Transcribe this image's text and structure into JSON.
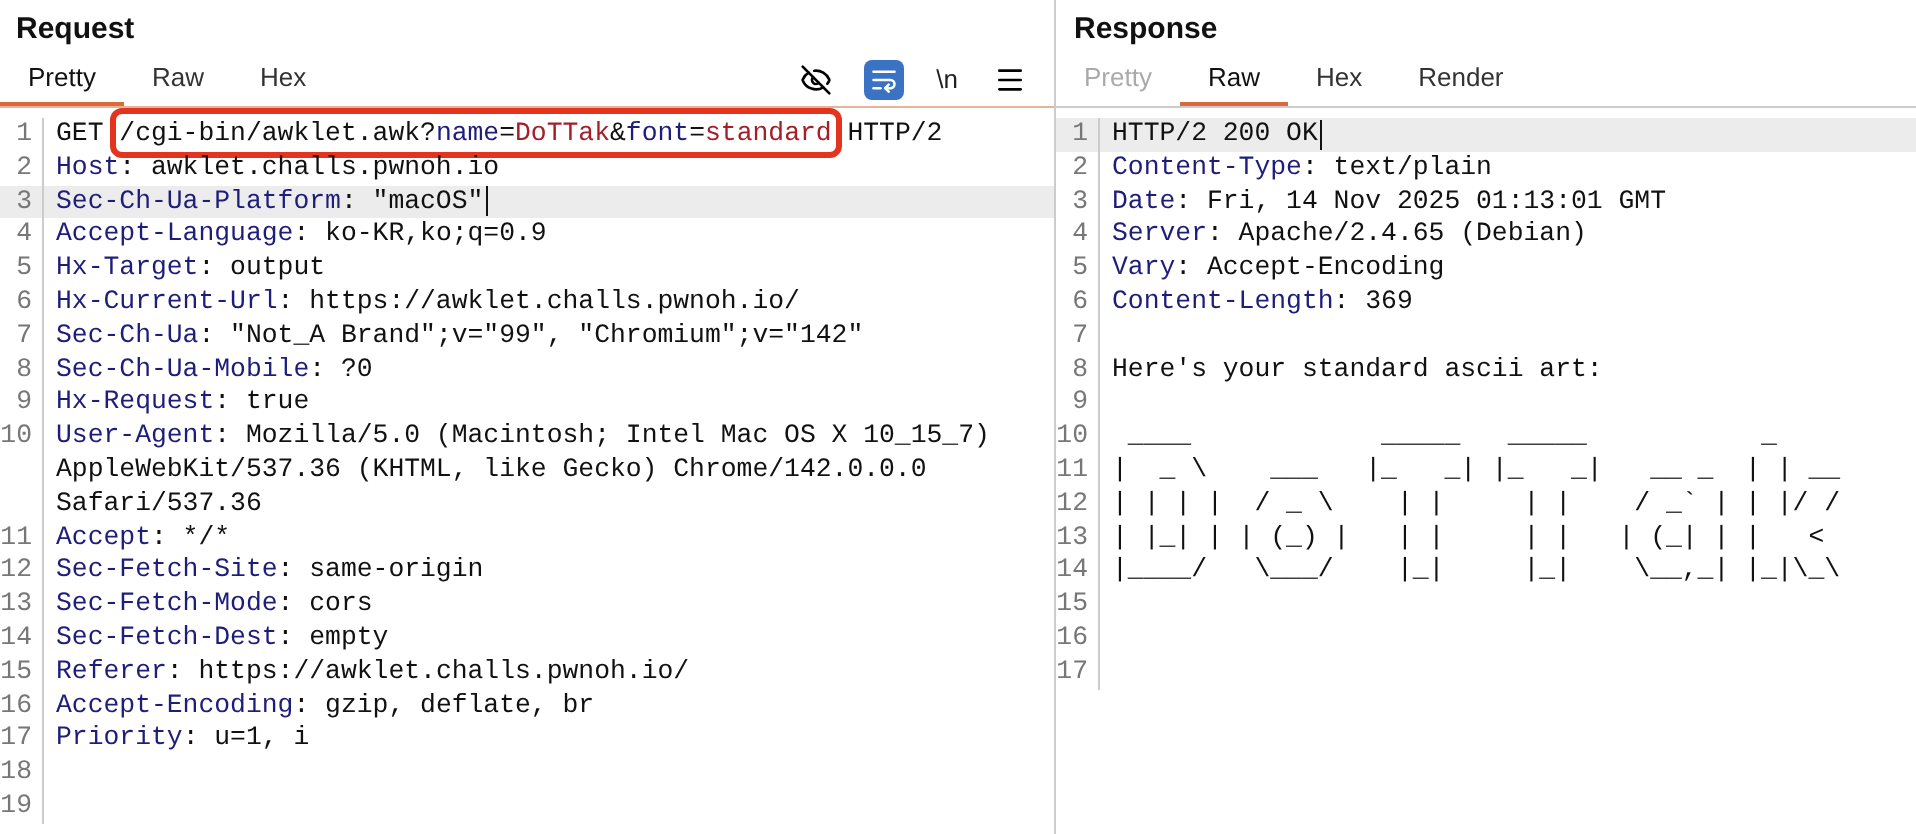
{
  "request": {
    "title": "Request",
    "tabs": [
      {
        "label": "Pretty",
        "selected": true,
        "disabled": false
      },
      {
        "label": "Raw",
        "selected": false,
        "disabled": false
      },
      {
        "label": "Hex",
        "selected": false,
        "disabled": false
      }
    ],
    "toolbar": [
      {
        "kind": "hide"
      },
      {
        "kind": "wrap",
        "on": true
      },
      {
        "kind": "text",
        "label": "\\n"
      },
      {
        "kind": "menu"
      }
    ],
    "lines": [
      {
        "number": "1",
        "current": false,
        "segments": [
          {
            "kind": "plain",
            "text": "GET "
          },
          {
            "kind": "box",
            "segments": [
              {
                "kind": "plain",
                "text": "/cgi-bin/awklet.awk?"
              },
              {
                "kind": "key",
                "text": "name"
              },
              {
                "kind": "plain",
                "text": "="
              },
              {
                "kind": "param",
                "text": "DoTTak"
              },
              {
                "kind": "plain",
                "text": "&"
              },
              {
                "kind": "key",
                "text": "font"
              },
              {
                "kind": "plain",
                "text": "="
              },
              {
                "kind": "param",
                "text": "standard"
              }
            ]
          },
          {
            "kind": "plain",
            "text": " HTTP/2"
          }
        ]
      },
      {
        "number": "2",
        "current": false,
        "segments": [
          {
            "kind": "key",
            "text": "Host"
          },
          {
            "kind": "plain",
            "text": ": awklet.challs.pwnoh.io"
          }
        ]
      },
      {
        "number": "3",
        "current": true,
        "segments": [
          {
            "kind": "key",
            "text": "Sec-Ch-Ua-Platform"
          },
          {
            "kind": "plain",
            "text": ": \"macOS\""
          }
        ]
      },
      {
        "number": "4",
        "current": false,
        "segments": [
          {
            "kind": "key",
            "text": "Accept-Language"
          },
          {
            "kind": "plain",
            "text": ": ko-KR,ko;q=0.9"
          }
        ]
      },
      {
        "number": "5",
        "current": false,
        "segments": [
          {
            "kind": "key",
            "text": "Hx-Target"
          },
          {
            "kind": "plain",
            "text": ": output"
          }
        ]
      },
      {
        "number": "6",
        "current": false,
        "segments": [
          {
            "kind": "key",
            "text": "Hx-Current-Url"
          },
          {
            "kind": "plain",
            "text": ": https://awklet.challs.pwnoh.io/"
          }
        ]
      },
      {
        "number": "7",
        "current": false,
        "segments": [
          {
            "kind": "key",
            "text": "Sec-Ch-Ua"
          },
          {
            "kind": "plain",
            "text": ": \"Not_A Brand\";v=\"99\", \"Chromium\";v=\"142\""
          }
        ]
      },
      {
        "number": "8",
        "current": false,
        "segments": [
          {
            "kind": "key",
            "text": "Sec-Ch-Ua-Mobile"
          },
          {
            "kind": "plain",
            "text": ": ?0"
          }
        ]
      },
      {
        "number": "9",
        "current": false,
        "segments": [
          {
            "kind": "key",
            "text": "Hx-Request"
          },
          {
            "kind": "plain",
            "text": ": true"
          }
        ]
      },
      {
        "number": "10",
        "current": false,
        "segments": [
          {
            "kind": "key",
            "text": "User-Agent"
          },
          {
            "kind": "plain",
            "text": ": Mozilla/5.0 (Macintosh; Intel Mac OS X 10_15_7)"
          }
        ],
        "continuation": [
          "AppleWebKit/537.36 (KHTML, like Gecko) Chrome/142.0.0.0",
          "Safari/537.36"
        ]
      },
      {
        "number": "11",
        "current": false,
        "segments": [
          {
            "kind": "key",
            "text": "Accept"
          },
          {
            "kind": "plain",
            "text": ": */*"
          }
        ]
      },
      {
        "number": "12",
        "current": false,
        "segments": [
          {
            "kind": "key",
            "text": "Sec-Fetch-Site"
          },
          {
            "kind": "plain",
            "text": ": same-origin"
          }
        ]
      },
      {
        "number": "13",
        "current": false,
        "segments": [
          {
            "kind": "key",
            "text": "Sec-Fetch-Mode"
          },
          {
            "kind": "plain",
            "text": ": cors"
          }
        ]
      },
      {
        "number": "14",
        "current": false,
        "segments": [
          {
            "kind": "key",
            "text": "Sec-Fetch-Dest"
          },
          {
            "kind": "plain",
            "text": ": empty"
          }
        ]
      },
      {
        "number": "15",
        "current": false,
        "segments": [
          {
            "kind": "key",
            "text": "Referer"
          },
          {
            "kind": "plain",
            "text": ": https://awklet.challs.pwnoh.io/"
          }
        ]
      },
      {
        "number": "16",
        "current": false,
        "segments": [
          {
            "kind": "key",
            "text": "Accept-Encoding"
          },
          {
            "kind": "plain",
            "text": ": gzip, deflate, br"
          }
        ]
      },
      {
        "number": "17",
        "current": false,
        "segments": [
          {
            "kind": "key",
            "text": "Priority"
          },
          {
            "kind": "plain",
            "text": ": u=1, i"
          }
        ]
      },
      {
        "number": "18",
        "current": false
      },
      {
        "number": "19",
        "current": false
      }
    ]
  },
  "response": {
    "title": "Response",
    "tabs": [
      {
        "label": "Pretty",
        "selected": false,
        "disabled": true
      },
      {
        "label": "Raw",
        "selected": true,
        "disabled": false
      },
      {
        "label": "Hex",
        "selected": false,
        "disabled": false
      },
      {
        "label": "Render",
        "selected": false,
        "disabled": false
      }
    ],
    "lines": [
      {
        "number": "1",
        "current": true,
        "segments": [
          {
            "kind": "plain",
            "text": "HTTP/2 200 OK"
          }
        ]
      },
      {
        "number": "2",
        "current": false,
        "segments": [
          {
            "kind": "key",
            "text": "Content-Type"
          },
          {
            "kind": "plain",
            "text": ": text/plain"
          }
        ]
      },
      {
        "number": "3",
        "current": false,
        "segments": [
          {
            "kind": "key",
            "text": "Date"
          },
          {
            "kind": "plain",
            "text": ": Fri, 14 Nov 2025 01:13:01 GMT"
          }
        ]
      },
      {
        "number": "4",
        "current": false,
        "segments": [
          {
            "kind": "key",
            "text": "Server"
          },
          {
            "kind": "plain",
            "text": ": Apache/2.4.65 (Debian)"
          }
        ]
      },
      {
        "number": "5",
        "current": false,
        "segments": [
          {
            "kind": "key",
            "text": "Vary"
          },
          {
            "kind": "plain",
            "text": ": Accept-Encoding"
          }
        ]
      },
      {
        "number": "6",
        "current": false,
        "segments": [
          {
            "kind": "key",
            "text": "Content-Length"
          },
          {
            "kind": "plain",
            "text": ": 369"
          }
        ]
      },
      {
        "number": "7",
        "current": false
      },
      {
        "number": "8",
        "current": false,
        "segments": [
          {
            "kind": "plain",
            "text": "Here's your standard ascii art:"
          }
        ]
      },
      {
        "number": "9",
        "current": false
      },
      {
        "number": "10",
        "current": false,
        "segments": [
          {
            "kind": "plain",
            "text": " ____            _____   _____           _"
          }
        ]
      },
      {
        "number": "11",
        "current": false,
        "segments": [
          {
            "kind": "plain",
            "text": "|  _ \\    ___   |_   _| |_   _|   __ _  | | __"
          }
        ]
      },
      {
        "number": "12",
        "current": false,
        "segments": [
          {
            "kind": "plain",
            "text": "| | | |  / _ \\    | |     | |    / _` | | |/ /"
          }
        ]
      },
      {
        "number": "13",
        "current": false,
        "segments": [
          {
            "kind": "plain",
            "text": "| |_| | | (_) |   | |     | |   | (_| | |   <"
          }
        ]
      },
      {
        "number": "14",
        "current": false,
        "segments": [
          {
            "kind": "plain",
            "text": "|____/   \\___/    |_|     |_|    \\__,_| |_|\\_\\"
          }
        ]
      },
      {
        "number": "15",
        "current": false
      },
      {
        "number": "16",
        "current": false
      },
      {
        "number": "17",
        "current": false
      }
    ]
  }
}
